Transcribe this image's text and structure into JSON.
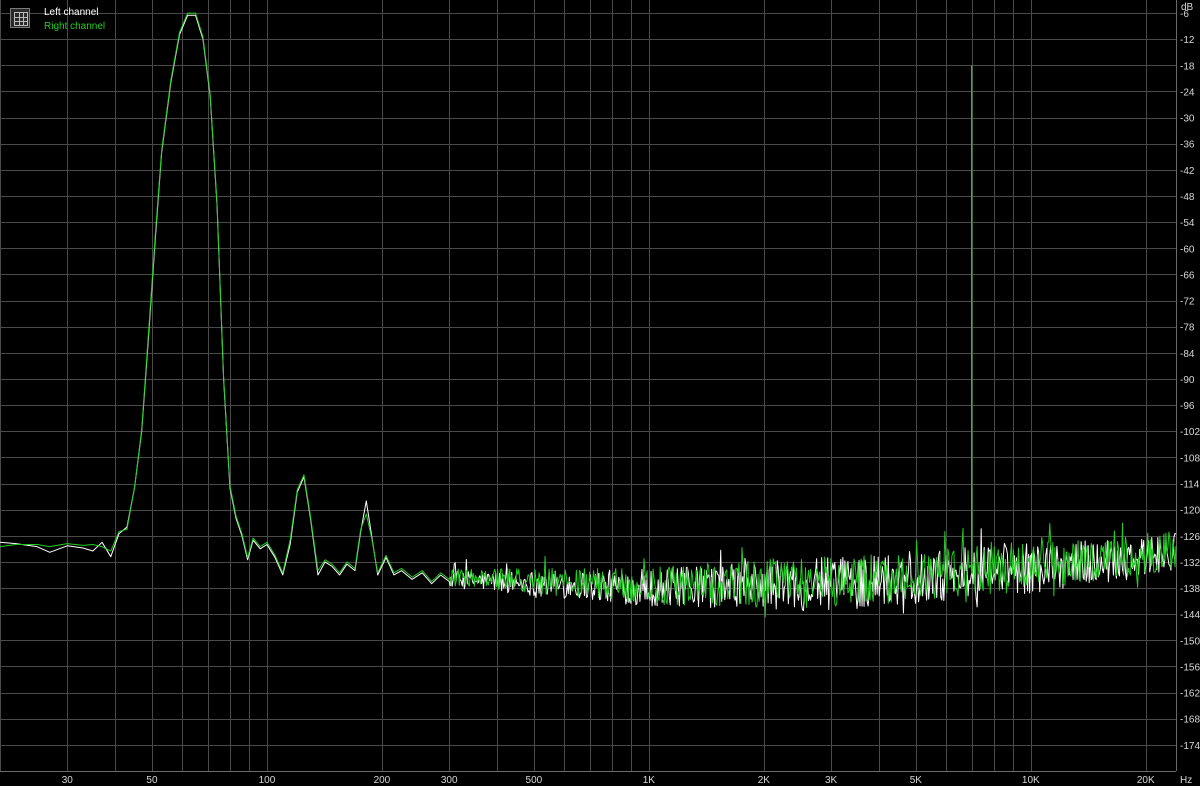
{
  "legend": {
    "left": "Left channel",
    "right": "Right channel"
  },
  "colors": {
    "background": "#000000",
    "grid": "#4a4a4a",
    "axis_text": "#d8d8d8",
    "left_channel": "#ffffff",
    "right_channel": "#22cc22"
  },
  "chart_data": {
    "type": "line",
    "title": "",
    "xlabel": "",
    "ylabel": "",
    "x_unit": "Hz",
    "y_unit": "dB",
    "x_scale": "log",
    "xlim": [
      20,
      24000
    ],
    "ylim": [
      -180,
      -3
    ],
    "grid": true,
    "legend_position": "top-left",
    "x_ticks": [
      {
        "value": 30,
        "label": "30"
      },
      {
        "value": 50,
        "label": "50"
      },
      {
        "value": 100,
        "label": "100"
      },
      {
        "value": 200,
        "label": "200"
      },
      {
        "value": 300,
        "label": "300"
      },
      {
        "value": 500,
        "label": "500"
      },
      {
        "value": 1000,
        "label": "1K"
      },
      {
        "value": 2000,
        "label": "2K"
      },
      {
        "value": 3000,
        "label": "3K"
      },
      {
        "value": 5000,
        "label": "5K"
      },
      {
        "value": 10000,
        "label": "10K"
      },
      {
        "value": 20000,
        "label": "20K"
      }
    ],
    "x_gridlines": [
      20,
      30,
      40,
      50,
      60,
      70,
      80,
      90,
      100,
      200,
      300,
      400,
      500,
      600,
      700,
      800,
      900,
      1000,
      2000,
      3000,
      4000,
      5000,
      6000,
      7000,
      8000,
      9000,
      10000,
      20000
    ],
    "y_ticks": [
      -6,
      -12,
      -18,
      -24,
      -30,
      -36,
      -42,
      -48,
      -54,
      -60,
      -66,
      -72,
      -78,
      -84,
      -90,
      -96,
      -102,
      -108,
      -114,
      -120,
      -126,
      -132,
      -138,
      -144,
      -150,
      -156,
      -162,
      -168,
      -174
    ],
    "series": [
      {
        "name": "Left channel",
        "color": "#ffffff",
        "noise_start_hz": 300,
        "points": [
          [
            20,
            -127.5
          ],
          [
            22,
            -127.8
          ],
          [
            25,
            -128.5
          ],
          [
            27,
            -129.8
          ],
          [
            30,
            -128.3
          ],
          [
            33,
            -128.8
          ],
          [
            35,
            -129.5
          ],
          [
            37,
            -127.5
          ],
          [
            39,
            -130.8
          ],
          [
            41,
            -125.5
          ],
          [
            43,
            -124.0
          ],
          [
            45,
            -115.0
          ],
          [
            47,
            -102.0
          ],
          [
            49,
            -80.0
          ],
          [
            51,
            -58.0
          ],
          [
            53,
            -38.0
          ],
          [
            56,
            -22.0
          ],
          [
            59,
            -11.0
          ],
          [
            62,
            -6.5
          ],
          [
            65,
            -6.5
          ],
          [
            68,
            -12.0
          ],
          [
            71,
            -25.0
          ],
          [
            74,
            -50.0
          ],
          [
            77,
            -90.0
          ],
          [
            80,
            -115.0
          ],
          [
            83,
            -122.0
          ],
          [
            86,
            -126.0
          ],
          [
            89,
            -131.5
          ],
          [
            92,
            -127.0
          ],
          [
            96,
            -129.0
          ],
          [
            100,
            -128.0
          ],
          [
            105,
            -131.0
          ],
          [
            110,
            -135.0
          ],
          [
            115,
            -128.0
          ],
          [
            120,
            -116.0
          ],
          [
            125,
            -112.5
          ],
          [
            130,
            -122.0
          ],
          [
            136,
            -135.0
          ],
          [
            142,
            -132.0
          ],
          [
            148,
            -133.0
          ],
          [
            155,
            -135.0
          ],
          [
            162,
            -132.5
          ],
          [
            170,
            -134.0
          ],
          [
            176,
            -125.0
          ],
          [
            182,
            -118.0
          ],
          [
            188,
            -126.0
          ],
          [
            195,
            -135.0
          ],
          [
            205,
            -131.0
          ],
          [
            215,
            -135.0
          ],
          [
            225,
            -134.0
          ],
          [
            240,
            -136.0
          ],
          [
            255,
            -134.5
          ],
          [
            270,
            -137.0
          ],
          [
            285,
            -135.0
          ],
          [
            300,
            -136.5
          ]
        ],
        "noise_floor": [
          [
            300,
            -136.0
          ],
          [
            1000,
            -138.0
          ],
          [
            3000,
            -137.0
          ],
          [
            10000,
            -133.5
          ],
          [
            24000,
            -130.0
          ]
        ],
        "spikes": []
      },
      {
        "name": "Right channel",
        "color": "#22cc22",
        "noise_start_hz": 300,
        "points": [
          [
            20,
            -128.5
          ],
          [
            22,
            -128.0
          ],
          [
            25,
            -128.0
          ],
          [
            27,
            -128.5
          ],
          [
            30,
            -127.8
          ],
          [
            33,
            -128.2
          ],
          [
            35,
            -128.0
          ],
          [
            37,
            -128.5
          ],
          [
            39,
            -129.5
          ],
          [
            41,
            -125.0
          ],
          [
            43,
            -124.5
          ],
          [
            45,
            -115.0
          ],
          [
            47,
            -101.5
          ],
          [
            49,
            -79.0
          ],
          [
            51,
            -57.0
          ],
          [
            53,
            -37.5
          ],
          [
            56,
            -21.5
          ],
          [
            59,
            -10.5
          ],
          [
            62,
            -6.0
          ],
          [
            65,
            -6.0
          ],
          [
            68,
            -11.5
          ],
          [
            71,
            -24.5
          ],
          [
            74,
            -49.5
          ],
          [
            77,
            -89.5
          ],
          [
            80,
            -114.5
          ],
          [
            83,
            -121.5
          ],
          [
            86,
            -125.5
          ],
          [
            89,
            -131.0
          ],
          [
            92,
            -126.5
          ],
          [
            96,
            -128.5
          ],
          [
            100,
            -127.5
          ],
          [
            105,
            -130.5
          ],
          [
            110,
            -134.5
          ],
          [
            115,
            -127.0
          ],
          [
            120,
            -115.5
          ],
          [
            125,
            -112.0
          ],
          [
            130,
            -121.5
          ],
          [
            136,
            -134.0
          ],
          [
            142,
            -131.5
          ],
          [
            148,
            -132.5
          ],
          [
            155,
            -134.5
          ],
          [
            162,
            -132.0
          ],
          [
            170,
            -133.5
          ],
          [
            176,
            -124.5
          ],
          [
            182,
            -121.0
          ],
          [
            188,
            -126.5
          ],
          [
            195,
            -134.5
          ],
          [
            205,
            -130.5
          ],
          [
            215,
            -134.5
          ],
          [
            225,
            -133.5
          ],
          [
            240,
            -135.5
          ],
          [
            255,
            -134.0
          ],
          [
            270,
            -136.5
          ],
          [
            285,
            -134.5
          ],
          [
            300,
            -136.0
          ]
        ],
        "noise_floor": [
          [
            300,
            -135.5
          ],
          [
            1000,
            -137.5
          ],
          [
            3000,
            -136.5
          ],
          [
            10000,
            -133.0
          ],
          [
            24000,
            -129.5
          ]
        ],
        "spikes": [
          [
            7000,
            -18.0
          ],
          [
            7000,
            -115.0
          ]
        ]
      }
    ]
  }
}
